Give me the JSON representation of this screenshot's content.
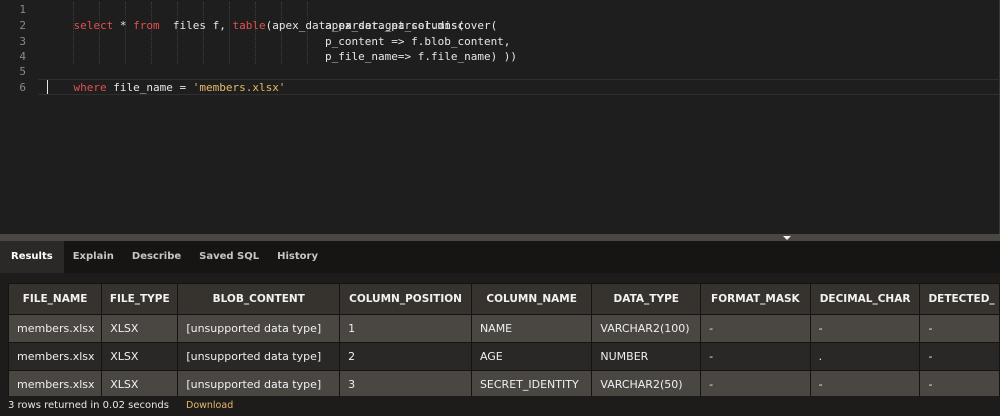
{
  "editor": {
    "line_numbers": [
      "1",
      "2",
      "3",
      "4",
      "5",
      "6"
    ],
    "line1": {
      "kw1": "select",
      "t1": " * ",
      "kw2": "from",
      "t2": "  files f, ",
      "fn": "table",
      "t3": "(apex_data_parser.get_columns("
    },
    "line2": {
      "text": "apex_data_parser.discover("
    },
    "line3": {
      "text": "p_content => f.blob_content,"
    },
    "line4": {
      "text": "p_file_name=> f.file_name) ))"
    },
    "line5": {
      "kw": "where",
      "t1": " file_name = ",
      "str": "'members.xlsx'"
    }
  },
  "tabs": [
    {
      "label": "Results",
      "active": true
    },
    {
      "label": "Explain"
    },
    {
      "label": "Describe"
    },
    {
      "label": "Saved SQL"
    },
    {
      "label": "History"
    }
  ],
  "results": {
    "columns": [
      "FILE_NAME",
      "FILE_TYPE",
      "BLOB_CONTENT",
      "COLUMN_POSITION",
      "COLUMN_NAME",
      "DATA_TYPE",
      "FORMAT_MASK",
      "DECIMAL_CHAR",
      "DETECTED_"
    ],
    "rows": [
      [
        "members.xlsx",
        "XLSX",
        "[unsupported data type]",
        "1",
        "NAME",
        "VARCHAR2(100)",
        "-",
        "-",
        "-"
      ],
      [
        "members.xlsx",
        "XLSX",
        "[unsupported data type]",
        "2",
        "AGE",
        "NUMBER",
        "-",
        ".",
        "-"
      ],
      [
        "members.xlsx",
        "XLSX",
        "[unsupported data type]",
        "3",
        "SECRET_IDENTITY",
        "VARCHAR2(50)",
        "-",
        "-",
        "-"
      ]
    ]
  },
  "status": {
    "text": "3 rows returned in 0.02 seconds",
    "download": "Download"
  }
}
